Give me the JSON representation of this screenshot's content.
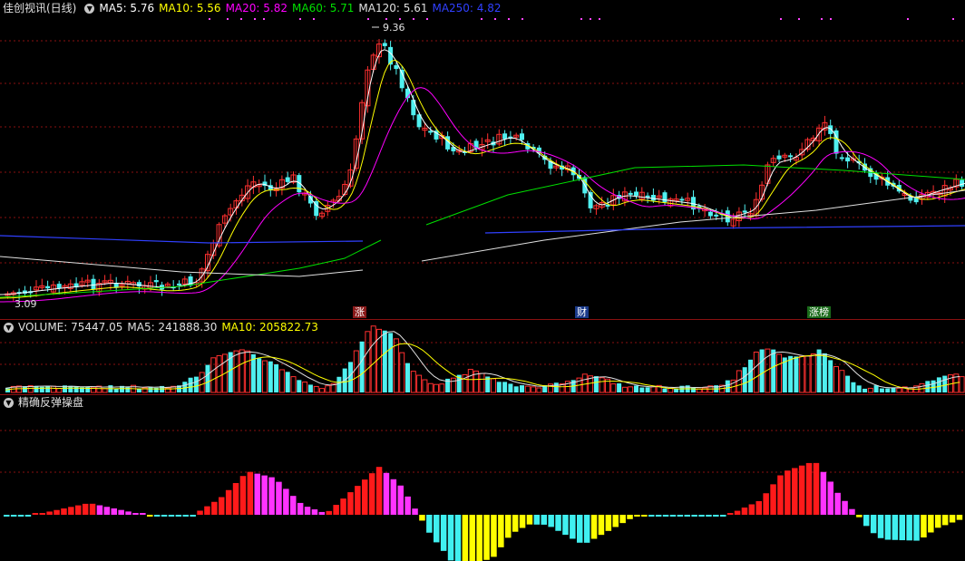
{
  "stock_title": "佳创视讯(日线)",
  "ma_legend": [
    {
      "label": "MA5: 5.76",
      "color": "#ffffff"
    },
    {
      "label": "MA10: 5.56",
      "color": "#ffff00"
    },
    {
      "label": "MA20: 5.82",
      "color": "#ff00ff"
    },
    {
      "label": "MA60: 5.71",
      "color": "#00e000"
    },
    {
      "label": "MA120: 5.61",
      "color": "#e0e0e0"
    },
    {
      "label": "MA250: 4.82",
      "color": "#3040ff"
    }
  ],
  "price_high_label": "9.36",
  "price_low_label": "3.09",
  "event_tags": [
    {
      "label": "涨",
      "bg": "#8a1a1a"
    },
    {
      "label": "财",
      "bg": "#1a3a8a"
    },
    {
      "label": "涨榜",
      "bg": "#1a6a1a"
    }
  ],
  "volume_legend": [
    {
      "label": "VOLUME: 75447.05",
      "color": "#e0e0e0"
    },
    {
      "label": "MA5: 241888.30",
      "color": "#e0e0e0"
    },
    {
      "label": "MA10: 205822.73",
      "color": "#ffff00"
    }
  ],
  "indicator_title": "精确反弹操盘",
  "colors": {
    "up": "#ff3030",
    "down": "#50f0f0",
    "grid": "#8a1010",
    "osc_red": "#ff1a1a",
    "osc_magenta": "#ff33ff",
    "osc_cyan": "#40f0f0",
    "osc_yellow": "#ffff00"
  }
}
